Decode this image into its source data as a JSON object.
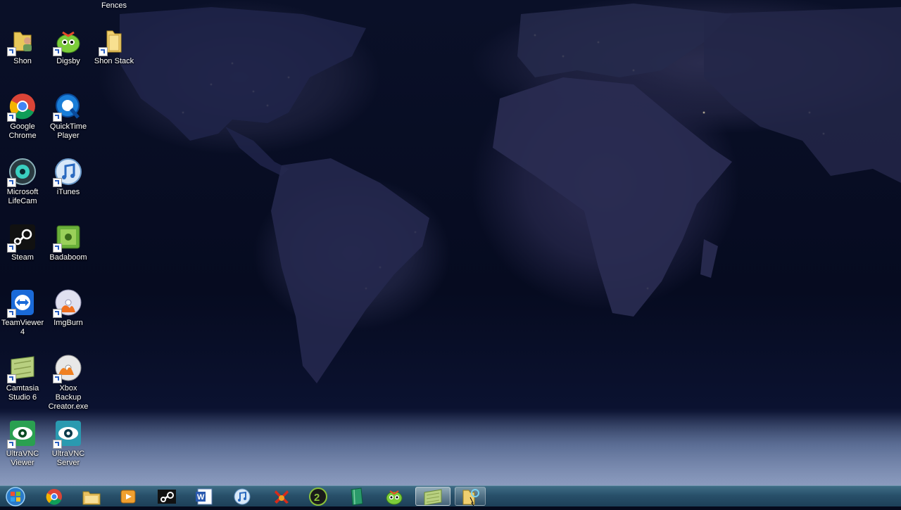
{
  "desktop": {
    "fence_title": "Fences",
    "icons": [
      {
        "label": "Shon",
        "icon": "user-folder-icon"
      },
      {
        "label": "Digsby",
        "icon": "digsby-icon"
      },
      {
        "label": "Shon Stack",
        "icon": "folder-icon"
      },
      {
        "label": "Google Chrome",
        "icon": "chrome-icon"
      },
      {
        "label": "QuickTime Player",
        "icon": "quicktime-icon"
      },
      {
        "label": "Microsoft LifeCam",
        "icon": "webcam-icon"
      },
      {
        "label": "iTunes",
        "icon": "itunes-icon"
      },
      {
        "label": "Steam",
        "icon": "steam-icon"
      },
      {
        "label": "Badaboom",
        "icon": "badaboom-icon"
      },
      {
        "label": "TeamViewer 4",
        "icon": "teamviewer-icon"
      },
      {
        "label": "ImgBurn",
        "icon": "imgburn-icon"
      },
      {
        "label": "Camtasia Studio 6",
        "icon": "camtasia-icon"
      },
      {
        "label": "Xbox Backup Creator.exe",
        "icon": "disc-flame-icon"
      },
      {
        "label": "UltraVNC Viewer",
        "icon": "ultravnc-eye-icon"
      },
      {
        "label": "UltraVNC Server",
        "icon": "ultravnc-eye-icon"
      }
    ]
  },
  "taskbar": {
    "start": "windows-start-orb",
    "pinned": [
      {
        "name": "chrome",
        "icon": "chrome-icon"
      },
      {
        "name": "explorer",
        "icon": "folder-library-icon"
      },
      {
        "name": "media-player",
        "icon": "media-player-icon"
      },
      {
        "name": "steam",
        "icon": "steam-icon"
      },
      {
        "name": "word",
        "icon": "word-icon"
      },
      {
        "name": "itunes",
        "icon": "itunes-icon"
      },
      {
        "name": "xbox-backup-creator",
        "icon": "red-x-icon"
      },
      {
        "name": "half-life-2",
        "icon": "hl2-icon"
      },
      {
        "name": "notebook",
        "icon": "green-book-icon"
      },
      {
        "name": "digsby",
        "icon": "digsby-icon"
      },
      {
        "name": "camtasia",
        "icon": "camtasia-icon"
      },
      {
        "name": "folder-search",
        "icon": "folder-search-icon"
      }
    ]
  },
  "colors": {
    "taskbar": "#28506a",
    "ocean": "#060b20",
    "city_lights": "#ffeec0"
  }
}
